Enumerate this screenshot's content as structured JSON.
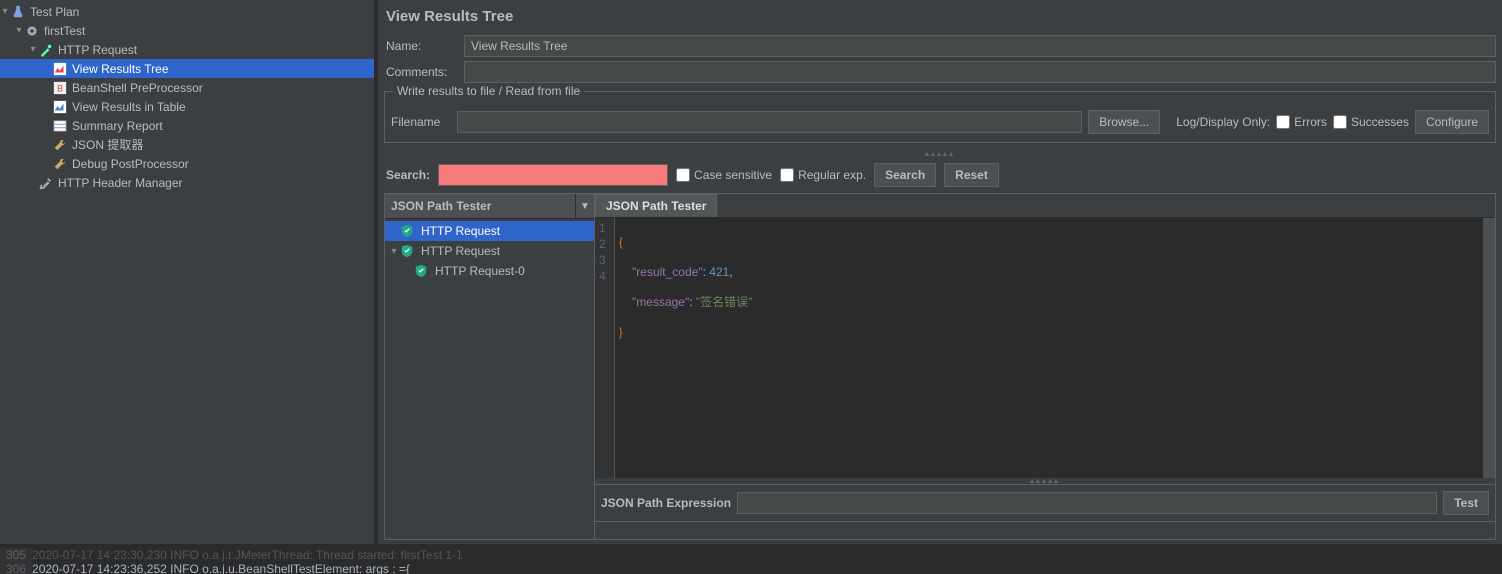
{
  "tree": {
    "root": "Test Plan",
    "group": "firstTest",
    "sampler": "HTTP Request",
    "children": [
      "View Results Tree",
      "BeanShell PreProcessor",
      "View Results in Table",
      "Summary Report",
      "JSON 提取器",
      "Debug PostProcessor"
    ],
    "header_mgr": "HTTP Header Manager"
  },
  "panel": {
    "title": "View Results Tree",
    "name_label": "Name:",
    "name_value": "View Results Tree",
    "comments_label": "Comments:",
    "fieldset_legend": "Write results to file / Read from file",
    "filename_label": "Filename",
    "filename_value": "",
    "browse_btn": "Browse...",
    "log_display_label": "Log/Display Only:",
    "errors_label": "Errors",
    "successes_label": "Successes",
    "configure_btn": "Configure"
  },
  "search": {
    "label": "Search:",
    "value": "",
    "case_label": "Case sensitive",
    "regex_label": "Regular exp.",
    "search_btn": "Search",
    "reset_btn": "Reset"
  },
  "results": {
    "renderer": "JSON Path Tester",
    "tab": "JSON Path Tester",
    "items": [
      {
        "label": "HTTP Request",
        "selected": true,
        "level": 0,
        "expandable": false
      },
      {
        "label": "HTTP Request",
        "selected": false,
        "level": 0,
        "expandable": true
      },
      {
        "label": "HTTP Request-0",
        "selected": false,
        "level": 1,
        "expandable": false
      }
    ],
    "code_lines": [
      "{",
      "    \"result_code\": 421,",
      "    \"message\": \"签名错误\"",
      "}"
    ],
    "expr_label": "JSON Path Expression",
    "expr_value": "",
    "test_btn": "Test"
  },
  "log": {
    "line1_no": "305",
    "line1_text": "2020-07-17 14:23:30,230 INFO o.a.j.t.JMeterThread: Thread started: firstTest 1-1",
    "line2_no": "306",
    "line2_text": "2020-07-17 14:23:36,252 INFO o.a.j.u.BeanShellTestElement: args : ={"
  }
}
